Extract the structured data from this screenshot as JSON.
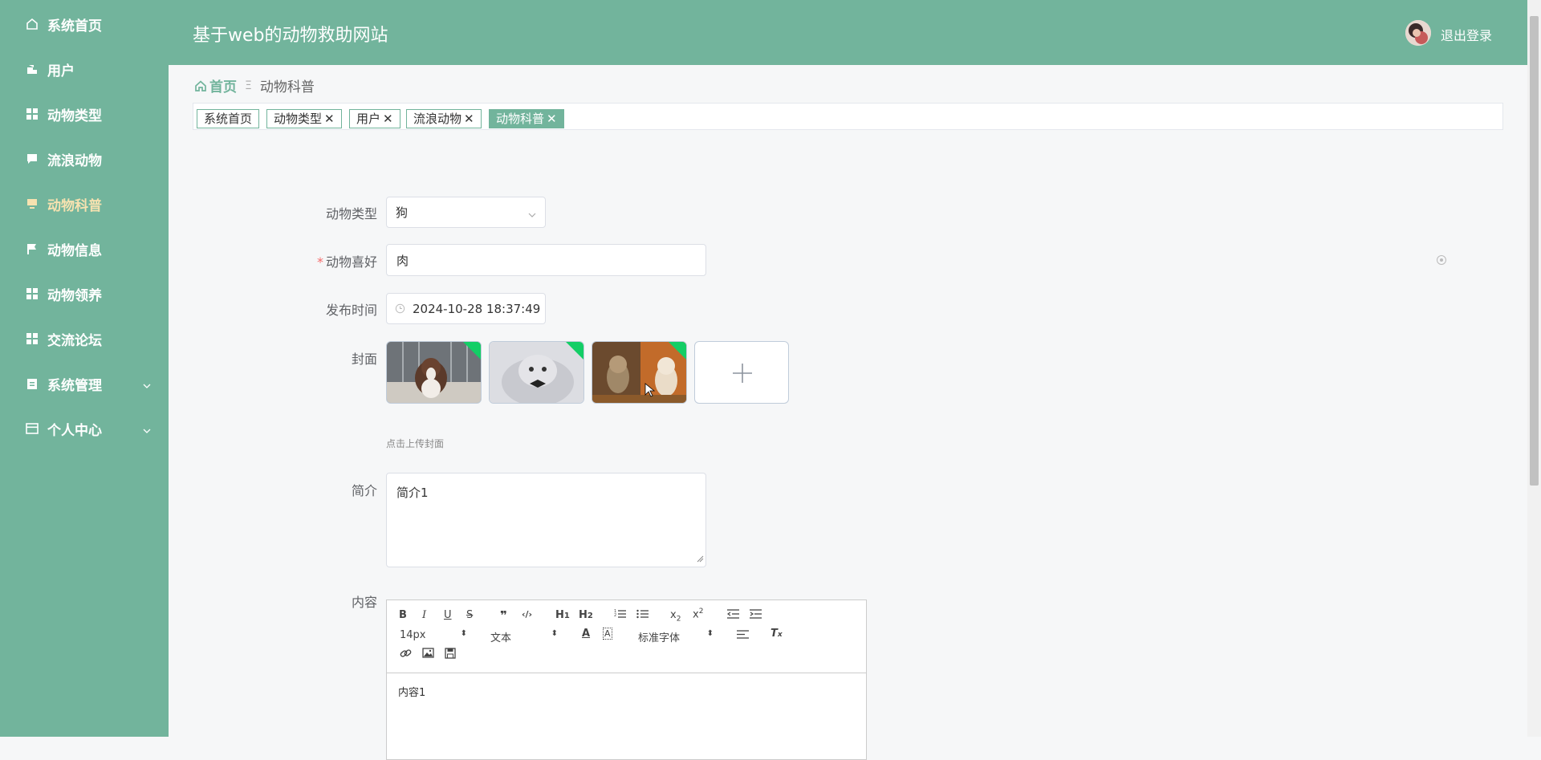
{
  "sidebar": {
    "items": [
      {
        "label": "系统首页",
        "icon": "home-icon"
      },
      {
        "label": "用户",
        "icon": "user-icon"
      },
      {
        "label": "动物类型",
        "icon": "grid-icon"
      },
      {
        "label": "流浪动物",
        "icon": "chat-icon"
      },
      {
        "label": "动物科普",
        "icon": "monitor-icon",
        "active": true
      },
      {
        "label": "动物信息",
        "icon": "flag-icon"
      },
      {
        "label": "动物领养",
        "icon": "grid-icon"
      },
      {
        "label": "交流论坛",
        "icon": "grid-icon"
      },
      {
        "label": "系统管理",
        "icon": "clipboard-icon",
        "expandable": true
      },
      {
        "label": "个人中心",
        "icon": "card-icon",
        "expandable": true
      }
    ]
  },
  "header": {
    "title": "基于web的动物救助网站",
    "logout": "退出登录"
  },
  "breadcrumb": {
    "home": "首页",
    "separator": "Ξ",
    "current": "动物科普"
  },
  "tags": [
    {
      "label": "系统首页",
      "closable": false
    },
    {
      "label": "动物类型",
      "closable": true
    },
    {
      "label": "用户",
      "closable": true
    },
    {
      "label": "流浪动物",
      "closable": true
    },
    {
      "label": "动物科普",
      "closable": true,
      "active": true
    }
  ],
  "form": {
    "animal_type": {
      "label": "动物类型",
      "value": "狗"
    },
    "animal_hobby": {
      "label": "动物喜好",
      "value": "肉",
      "required": true
    },
    "publish_time": {
      "label": "发布时间",
      "value": "2024-10-28 18:37:49"
    },
    "cover": {
      "label": "封面",
      "hint": "点击上传封面"
    },
    "intro": {
      "label": "简介",
      "value": "简介1"
    },
    "content": {
      "label": "内容",
      "value": "内容1"
    }
  },
  "editor": {
    "font_size": "14px",
    "text_type": "文本",
    "font_family": "标准字体"
  },
  "colors": {
    "primary": "#72b49c",
    "active_nav": "#f7e2b0",
    "required": "#f56c6c",
    "success_corner": "#13ce66"
  }
}
